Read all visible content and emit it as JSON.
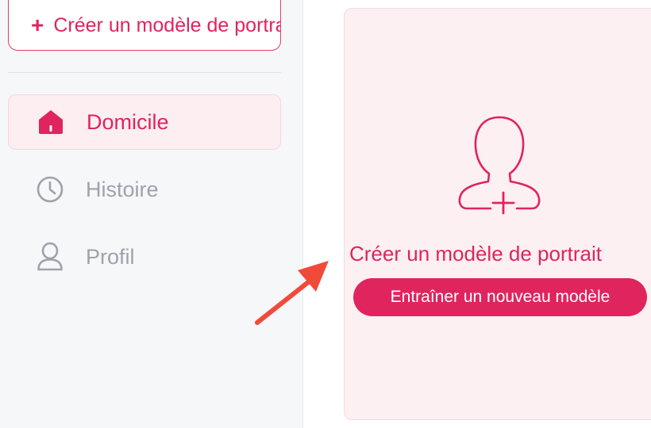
{
  "sidebar": {
    "create_button": {
      "label": "Créer un modèle de portrait",
      "icon": "plus-icon"
    },
    "nav": [
      {
        "label": "Domicile",
        "icon": "home-icon",
        "active": true
      },
      {
        "label": "Histoire",
        "icon": "clock-icon",
        "active": false
      },
      {
        "label": "Profil",
        "icon": "user-icon",
        "active": false
      }
    ]
  },
  "main": {
    "card": {
      "icon": "user-plus-icon",
      "title": "Créer un modèle de portrait",
      "button_label": "Entraîner un nouveau modèle"
    }
  },
  "annotation": {
    "icon": "red-arrow-icon"
  },
  "colors": {
    "accent": "#e0245e",
    "card_bg": "#fdf0f2",
    "inactive_text": "#9ea2aa",
    "sidebar_bg": "#f6f7f9",
    "arrow": "#f04a3a"
  }
}
